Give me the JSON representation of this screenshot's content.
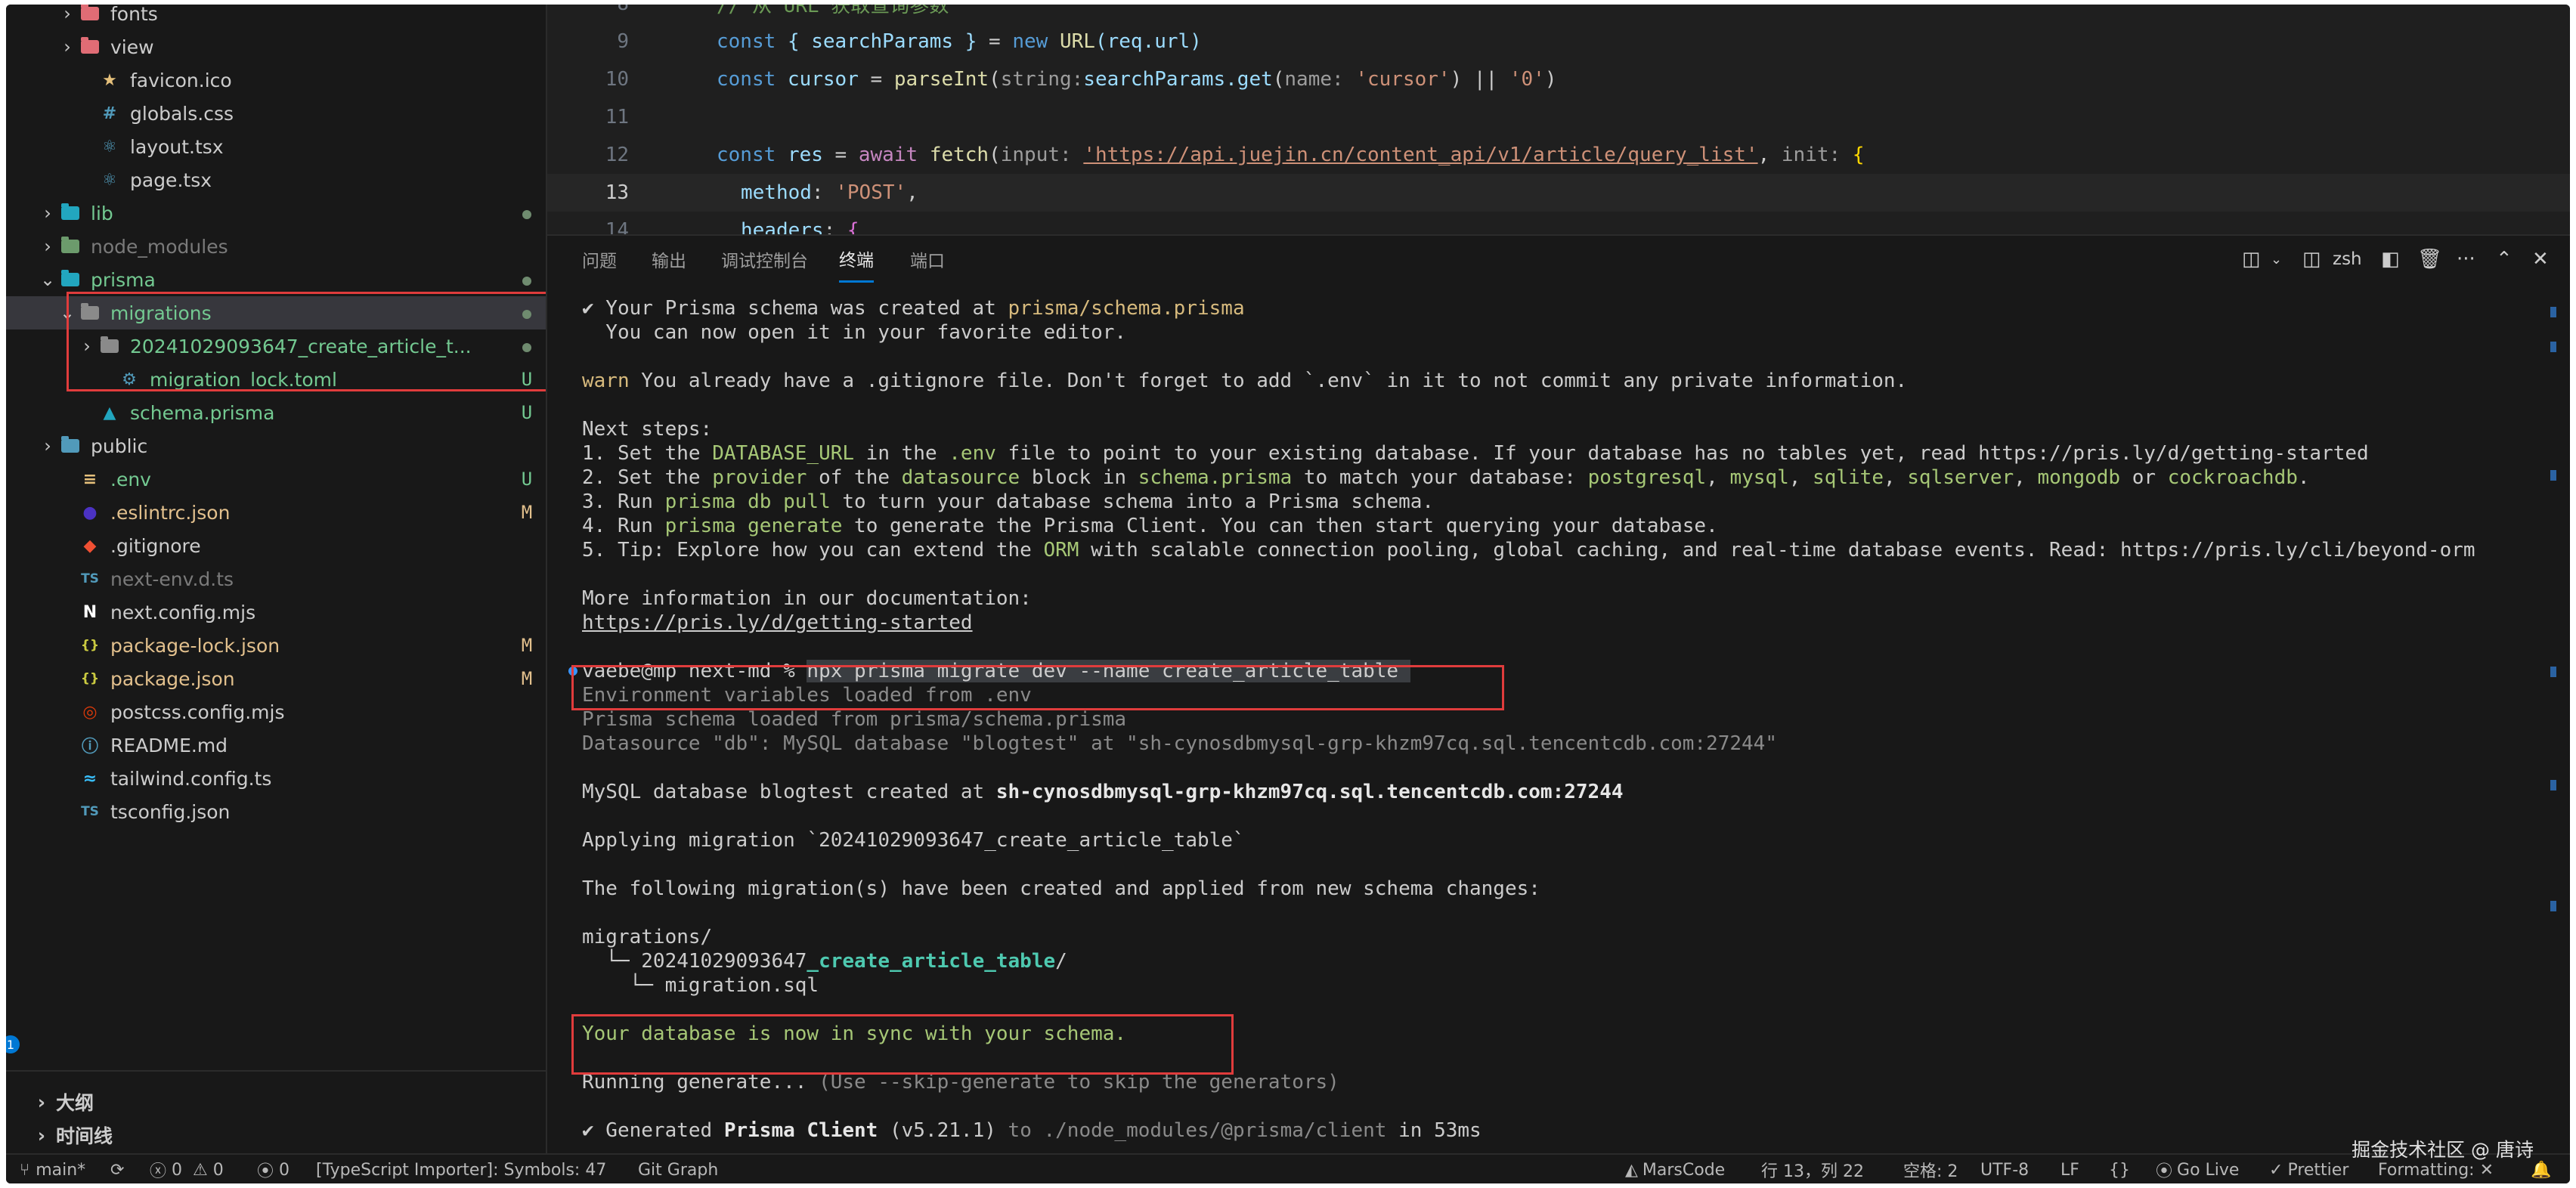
{
  "explorer": {
    "items": [
      {
        "label": "fonts",
        "status": "",
        "color": "#cccccc"
      },
      {
        "label": "view",
        "status": "",
        "color": "#cccccc"
      },
      {
        "label": "favicon.ico",
        "status": "",
        "color": "#cccccc"
      },
      {
        "label": "globals.css",
        "status": "",
        "color": "#cccccc"
      },
      {
        "label": "layout.tsx",
        "status": "",
        "color": "#cccccc"
      },
      {
        "label": "page.tsx",
        "status": "",
        "color": "#cccccc"
      },
      {
        "label": "lib",
        "status": "dot",
        "color": "#73c991"
      },
      {
        "label": "node_modules",
        "status": "",
        "color": "#7a7a7a"
      },
      {
        "label": "prisma",
        "status": "dot",
        "color": "#73c991"
      },
      {
        "label": "migrations",
        "status": "dot",
        "color": "#73c991"
      },
      {
        "label": "20241029093647_create_article_t...",
        "status": "dot",
        "color": "#73c991"
      },
      {
        "label": "migration_lock.toml",
        "status": "U",
        "color": "#73c991"
      },
      {
        "label": "schema.prisma",
        "status": "U",
        "color": "#73c991"
      },
      {
        "label": "public",
        "status": "",
        "color": "#cccccc"
      },
      {
        "label": ".env",
        "status": "U",
        "color": "#73c991"
      },
      {
        "label": ".eslintrc.json",
        "status": "M",
        "color": "#e2c08d"
      },
      {
        "label": ".gitignore",
        "status": "",
        "color": "#cccccc"
      },
      {
        "label": "next-env.d.ts",
        "status": "",
        "color": "#7a7a7a"
      },
      {
        "label": "next.config.mjs",
        "status": "",
        "color": "#cccccc"
      },
      {
        "label": "package-lock.json",
        "status": "M",
        "color": "#e2c08d"
      },
      {
        "label": "package.json",
        "status": "M",
        "color": "#e2c08d"
      },
      {
        "label": "postcss.config.mjs",
        "status": "",
        "color": "#cccccc"
      },
      {
        "label": "README.md",
        "status": "",
        "color": "#cccccc"
      },
      {
        "label": "tailwind.config.ts",
        "status": "",
        "color": "#cccccc"
      },
      {
        "label": "tsconfig.json",
        "status": "",
        "color": "#cccccc"
      }
    ],
    "outline_label": "大纲",
    "timeline_label": "时间线",
    "badge": "1"
  },
  "editor": {
    "lines": [
      {
        "num": "8",
        "text": "// 从 URL 获取查询参数"
      },
      {
        "num": "9",
        "text": ""
      },
      {
        "num": "10",
        "text": ""
      },
      {
        "num": "11",
        "text": ""
      },
      {
        "num": "12",
        "text": ""
      },
      {
        "num": "13",
        "text": ""
      },
      {
        "num": "14",
        "text": ""
      }
    ],
    "tokens": {
      "const": "const",
      "searchParams_destructure": "{ searchParams }",
      "eq": " = ",
      "new": "new",
      "URL": "URL",
      "req_url": "(req.url)",
      "cursor": "cursor",
      "parseInt": "parseInt",
      "hint_string": "string:",
      "searchParams_get": "searchParams.get",
      "hint_name": "name:",
      "str_cursor": "'cursor'",
      "or": " || ",
      "str_zero": "'0'",
      "res": "res",
      "await": "await",
      "fetch": "fetch",
      "hint_input": "input:",
      "url": "'https://api.juejin.cn/content_api/v1/article/query_list'",
      "hint_init": "init:",
      "method": "method",
      "post": "'POST'",
      "headers": "headers"
    }
  },
  "panel": {
    "tabs": [
      "问题",
      "输出",
      "调试控制台",
      "终端",
      "端口"
    ],
    "active_tab": "终端",
    "shell": "zsh",
    "more": "···",
    "terminal": {
      "l1a": "✔ Your Prisma schema was created at ",
      "l1b": "prisma/schema.prisma",
      "l2": "  You can now open it in your favorite editor.",
      "l3a": "warn",
      "l3b": " You already have a .gitignore file. Don't forget to add `.env` in it to not commit any private information.",
      "l4": "Next steps:",
      "s1a": "1. Set the ",
      "s1b": "DATABASE_URL",
      "s1c": " in the ",
      "s1d": ".env",
      "s1e": " file to point to your existing database. If your database has no tables yet, read https://pris.ly/d/getting-started",
      "s2a": "2. Set the ",
      "s2b": "provider",
      "s2c": " of the ",
      "s2d": "datasource",
      "s2e": " block in ",
      "s2f": "schema.prisma",
      "s2g": " to match your database: ",
      "s2h": "postgresql",
      "s2i": ", ",
      "s2j": "mysql",
      "s2k": "sqlite",
      "s2l": "sqlserver",
      "s2m": "mongodb",
      "s2n": " or ",
      "s2o": "cockroachdb",
      "s2p": ".",
      "s3a": "3. Run ",
      "s3b": "prisma db pull",
      "s3c": " to turn your database schema into a Prisma schema.",
      "s4a": "4. Run ",
      "s4b": "prisma generate",
      "s4c": " to generate the Prisma Client. You can then start querying your database.",
      "s5a": "5. Tip: Explore how you can extend the ",
      "s5b": "ORM",
      "s5c": " with scalable connection pooling, global caching, and real-time database events. Read: https://pris.ly/cli/beyond-orm",
      "more_info": "More information in our documentation:",
      "doc_link": "https://pris.ly/d/getting-started",
      "prompt": "vaebe@mp next-md % ",
      "command": "npx prisma migrate dev --name create_article_table ",
      "env_loaded": "Environment variables loaded from .env",
      "schema_loaded": "Prisma schema loaded from prisma/schema.prisma",
      "datasource": "Datasource \"db\": MySQL database \"blogtest\" at \"sh-cynosdbmysql-grp-khzm97cq.sql.tencentcdb.com:27244\"",
      "db_created_a": "MySQL database blogtest created at ",
      "db_created_b": "sh-cynosdbmysql-grp-khzm97cq.sql.tencentcdb.com:27244",
      "applying": "Applying migration `20241029093647_create_article_table`",
      "following": "The following migration(s) have been created and applied from new schema changes:",
      "mig_dir": "migrations/",
      "mig_sub_a": "  └─ 20241029093647",
      "mig_sub_b": "_create_article_table",
      "mig_sub_c": "/",
      "mig_file": "    └─ migration.sql",
      "in_sync": "Your database is now in sync with your schema.",
      "running_a": "Running generate... ",
      "running_b": "(Use --skip-generate to skip the generators)",
      "gen_a": "✔ Generated ",
      "gen_b": "Prisma Client",
      "gen_c": " (v5.21.1)",
      "gen_d": " to ./node_modules/@prisma/client",
      "gen_e": " in 53ms"
    }
  },
  "statusbar": {
    "branch": "main*",
    "errors": "0",
    "warnings": "0",
    "ports": "0",
    "importer": "[TypeScript Importer]: Symbols: 47",
    "git_graph": "Git Graph",
    "marscode": "MarsCode",
    "position": "行 13，列 22",
    "spaces": "空格: 2",
    "encoding": "UTF-8",
    "eol": "LF",
    "lang_braces": "{}",
    "golive": "Go Live",
    "prettier": "Prettier",
    "formatting": "Formatting: ✕"
  },
  "watermark": "掘金技术社区 @ 唐诗",
  "colors": {
    "accent": "#0078d4",
    "highlight_box": "#e03c3c",
    "git_untracked": "#73c991",
    "git_modified": "#e2c08d"
  }
}
